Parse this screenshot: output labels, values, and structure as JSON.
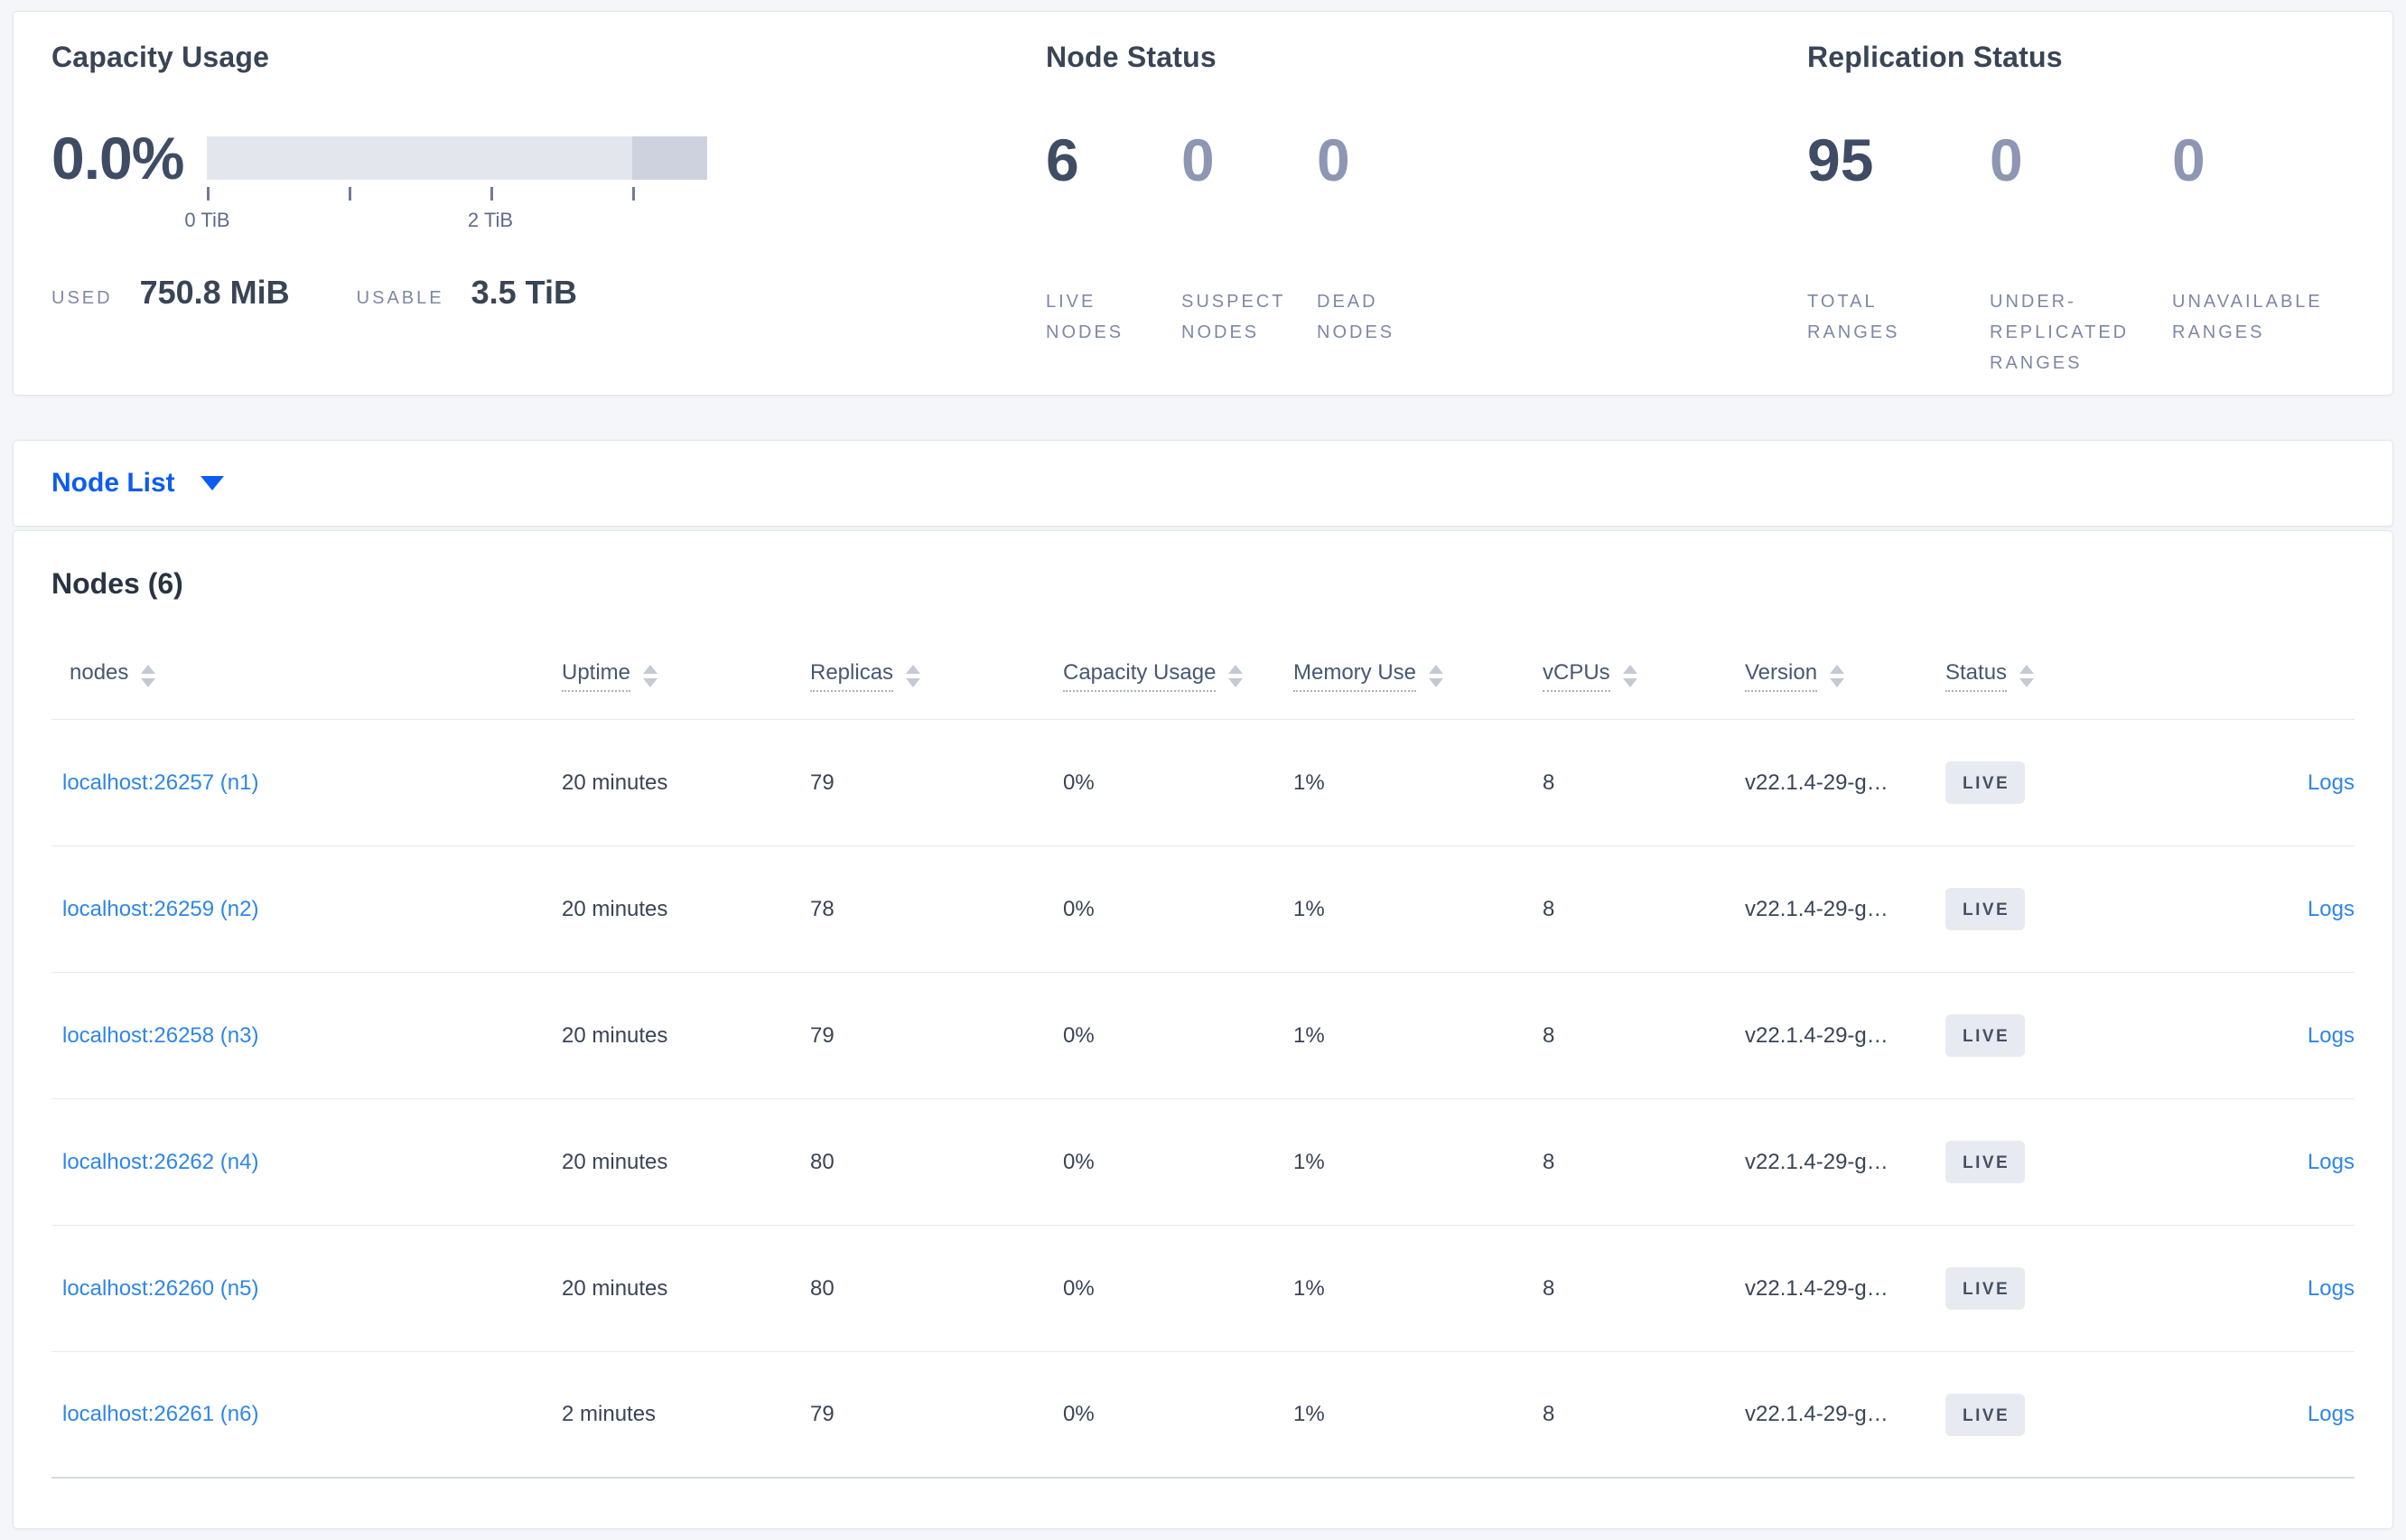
{
  "summary": {
    "capacity_usage": {
      "title": "Capacity Usage",
      "percent_used": "0.0%",
      "bar": {
        "ticks": [
          {
            "pos": 0,
            "label": "0 TiB"
          },
          {
            "pos": 28.3,
            "label": ""
          },
          {
            "pos": 56.6,
            "label": "2 TiB"
          },
          {
            "pos": 85,
            "label": ""
          }
        ],
        "dark_from_pct": 85
      },
      "used_label": "USED",
      "used_value": "750.8 MiB",
      "usable_label": "USABLE",
      "usable_value": "3.5 TiB"
    },
    "node_status": {
      "title": "Node Status",
      "metrics": [
        {
          "value": "6",
          "label": "LIVE NODES",
          "emphasis": true
        },
        {
          "value": "0",
          "label": "SUSPECT NODES",
          "emphasis": false
        },
        {
          "value": "0",
          "label": "DEAD NODES",
          "emphasis": false
        }
      ]
    },
    "replication_status": {
      "title": "Replication Status",
      "metrics": [
        {
          "value": "95",
          "label": "TOTAL RANGES",
          "emphasis": true
        },
        {
          "value": "0",
          "label": "UNDER-REPLICATED RANGES",
          "emphasis": false
        },
        {
          "value": "0",
          "label": "UNAVAILABLE RANGES",
          "emphasis": false
        }
      ]
    }
  },
  "node_list_selector": {
    "label": "Node List"
  },
  "nodes_table": {
    "title": "Nodes (6)",
    "columns": [
      {
        "key": "nodes",
        "label": "nodes",
        "dotted": false
      },
      {
        "key": "uptime",
        "label": "Uptime",
        "dotted": true
      },
      {
        "key": "replicas",
        "label": "Replicas",
        "dotted": true
      },
      {
        "key": "capacity-usage",
        "label": "Capacity Usage",
        "dotted": true
      },
      {
        "key": "memory-use",
        "label": "Memory Use",
        "dotted": true
      },
      {
        "key": "vcpus",
        "label": "vCPUs",
        "dotted": true
      },
      {
        "key": "version",
        "label": "Version",
        "dotted": true
      },
      {
        "key": "status",
        "label": "Status",
        "dotted": true
      }
    ],
    "logs_label": "Logs",
    "rows": [
      {
        "node": "localhost:26257 (n1)",
        "uptime": "20 minutes",
        "replicas": "79",
        "capacity_usage": "0%",
        "memory_use": "1%",
        "vcpus": "8",
        "version": "v22.1.4-29-g…",
        "status": "LIVE"
      },
      {
        "node": "localhost:26259 (n2)",
        "uptime": "20 minutes",
        "replicas": "78",
        "capacity_usage": "0%",
        "memory_use": "1%",
        "vcpus": "8",
        "version": "v22.1.4-29-g…",
        "status": "LIVE"
      },
      {
        "node": "localhost:26258 (n3)",
        "uptime": "20 minutes",
        "replicas": "79",
        "capacity_usage": "0%",
        "memory_use": "1%",
        "vcpus": "8",
        "version": "v22.1.4-29-g…",
        "status": "LIVE"
      },
      {
        "node": "localhost:26262 (n4)",
        "uptime": "20 minutes",
        "replicas": "80",
        "capacity_usage": "0%",
        "memory_use": "1%",
        "vcpus": "8",
        "version": "v22.1.4-29-g…",
        "status": "LIVE"
      },
      {
        "node": "localhost:26260 (n5)",
        "uptime": "20 minutes",
        "replicas": "80",
        "capacity_usage": "0%",
        "memory_use": "1%",
        "vcpus": "8",
        "version": "v22.1.4-29-g…",
        "status": "LIVE"
      },
      {
        "node": "localhost:26261 (n6)",
        "uptime": "2 minutes",
        "replicas": "79",
        "capacity_usage": "0%",
        "memory_use": "1%",
        "vcpus": "8",
        "version": "v22.1.4-29-g…",
        "status": "LIVE"
      }
    ]
  },
  "colors": {
    "accent_blue": "#0d5bf1",
    "link_blue": "#2e86e8",
    "badge_bg": "#e7eaf1",
    "badge_text": "#475064",
    "bar_track": "#e4e6ee",
    "bar_track_dark": "#ced2df",
    "page_bg": "#f4f6fa",
    "text_dark": "#3e4c64",
    "text_muted": "#7d88a6"
  }
}
